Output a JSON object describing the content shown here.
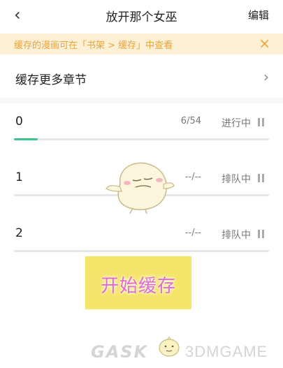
{
  "header": {
    "back_icon": "chevron-left-icon",
    "back_glyph": "‹",
    "title": "放开那个女巫",
    "edit_label": "编辑"
  },
  "notice": {
    "text": "缓存的漫画可在「书架 > 缓存」中查看",
    "close_glyph": "×",
    "color": "#e9a43a",
    "background": "#fdf0d4"
  },
  "cache_more": {
    "label": "缓存更多章节",
    "arrow_glyph": "›"
  },
  "chapters": [
    {
      "name": "0",
      "progress": "6/54",
      "status": "进行中",
      "progress_fraction": 0.0926
    },
    {
      "name": "1",
      "progress": "--/--",
      "status": "排队中",
      "progress_fraction": 0
    },
    {
      "name": "2",
      "progress": "--/--",
      "status": "排队中",
      "progress_fraction": 0
    }
  ],
  "start_button": {
    "label": "开始缓存",
    "background": "#f6e56a",
    "text_color": "#e06bd0"
  },
  "watermark": {
    "text_left": "GASK",
    "text_right": "3DMGAME"
  },
  "colors": {
    "progress_fill": "#3cc48a",
    "track": "#e6e6e6"
  }
}
